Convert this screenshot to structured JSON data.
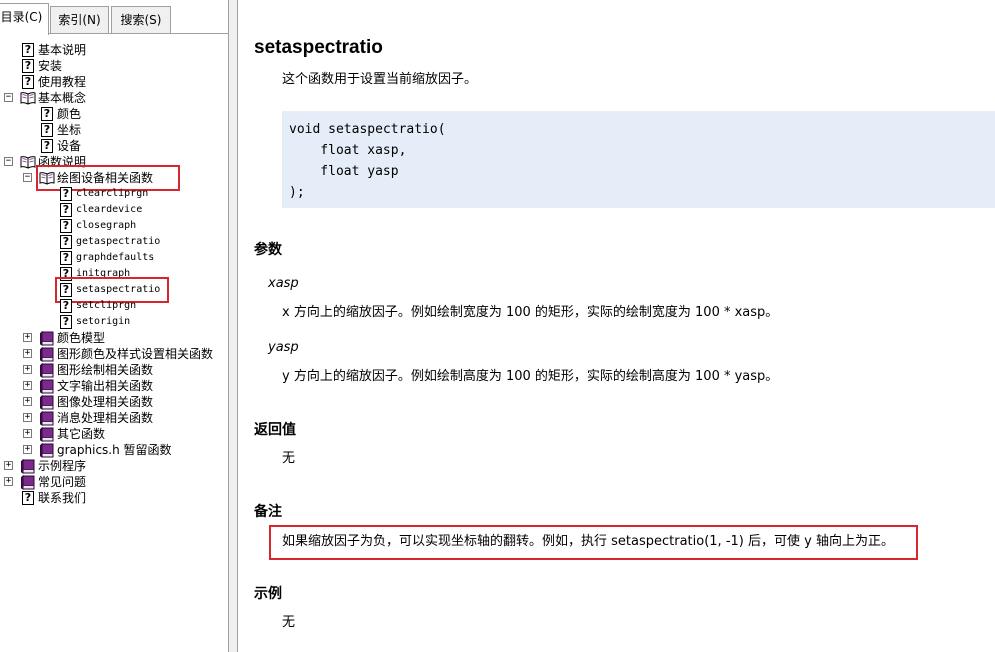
{
  "tabs": [
    {
      "label": "目录(C)",
      "active": true
    },
    {
      "label": "索引(N)",
      "active": false
    },
    {
      "label": "搜索(S)",
      "active": false
    }
  ],
  "tree": [
    {
      "label": "基本说明",
      "icon": "help-page-icon"
    },
    {
      "label": "安装",
      "icon": "help-page-icon"
    },
    {
      "label": "使用教程",
      "icon": "help-page-icon"
    },
    {
      "label": "基本概念",
      "icon": "open-book-icon",
      "expanded": true
    },
    {
      "label": "颜色",
      "icon": "help-page-icon"
    },
    {
      "label": "坐标",
      "icon": "help-page-icon"
    },
    {
      "label": "设备",
      "icon": "help-page-icon"
    },
    {
      "label": "函数说明",
      "icon": "open-book-icon",
      "expanded": true
    },
    {
      "label": "绘图设备相关函数",
      "icon": "open-book-icon",
      "expanded": true,
      "highlighted": true
    },
    {
      "label": "clearcliprgn",
      "icon": "help-page-icon"
    },
    {
      "label": "cleardevice",
      "icon": "help-page-icon"
    },
    {
      "label": "closegraph",
      "icon": "help-page-icon"
    },
    {
      "label": "getaspectratio",
      "icon": "help-page-icon"
    },
    {
      "label": "graphdefaults",
      "icon": "help-page-icon"
    },
    {
      "label": "initgraph",
      "icon": "help-page-icon"
    },
    {
      "label": "setaspectratio",
      "icon": "help-page-icon",
      "highlighted": true
    },
    {
      "label": "setcliprgn",
      "icon": "help-page-icon"
    },
    {
      "label": "setorigin",
      "icon": "help-page-icon"
    },
    {
      "label": "颜色模型",
      "icon": "closed-book-icon",
      "expanded": false
    },
    {
      "label": "图形颜色及样式设置相关函数",
      "icon": "closed-book-icon",
      "expanded": false
    },
    {
      "label": "图形绘制相关函数",
      "icon": "closed-book-icon",
      "expanded": false
    },
    {
      "label": "文字输出相关函数",
      "icon": "closed-book-icon",
      "expanded": false
    },
    {
      "label": "图像处理相关函数",
      "icon": "closed-book-icon",
      "expanded": false
    },
    {
      "label": "消息处理相关函数",
      "icon": "closed-book-icon",
      "expanded": false
    },
    {
      "label": "其它函数",
      "icon": "closed-book-icon",
      "expanded": false
    },
    {
      "label": "graphics.h 暂留函数",
      "icon": "closed-book-icon",
      "expanded": false
    },
    {
      "label": "示例程序",
      "icon": "closed-book-icon",
      "expanded": false
    },
    {
      "label": "常见问题",
      "icon": "closed-book-icon",
      "expanded": false
    },
    {
      "label": "联系我们",
      "icon": "help-page-icon"
    }
  ],
  "doc": {
    "title": "setaspectratio",
    "summary": "这个函数用于设置当前缩放因子。",
    "code": "void setaspectratio(\n    float xasp,\n    float yasp\n);",
    "params_heading": "参数",
    "params": [
      {
        "name": "xasp",
        "desc": "x 方向上的缩放因子。例如绘制宽度为 100 的矩形，实际的绘制宽度为 100 * xasp。"
      },
      {
        "name": "yasp",
        "desc": "y 方向上的缩放因子。例如绘制高度为 100 的矩形，实际的绘制高度为 100 * yasp。"
      }
    ],
    "return_heading": "返回值",
    "return_value": "无",
    "remarks_heading": "备注",
    "remarks": "如果缩放因子为负，可以实现坐标轴的翻转。例如，执行 setaspectratio(1, -1) 后，可使 y 轴向上为正。",
    "example_heading": "示例",
    "example": "无"
  },
  "colors": {
    "highlight": "#d8262f",
    "code_bg": "#e5eef8",
    "book_purple": "#7b2a8c"
  }
}
